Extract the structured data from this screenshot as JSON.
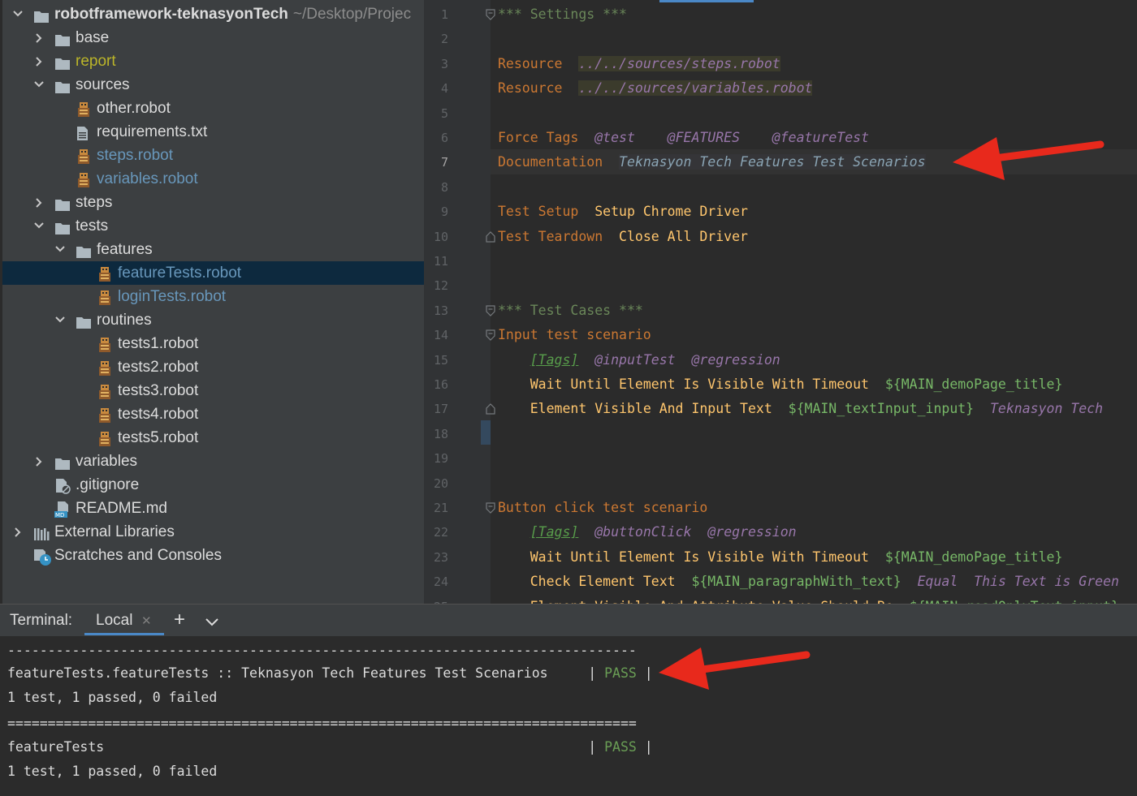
{
  "project_tree": [
    {
      "label": "robotframework-teknasyonTech",
      "extra": "~/Desktop/Projec",
      "type": "folder",
      "state": "open",
      "bold": true
    },
    {
      "label": "base",
      "type": "folder",
      "state": "closed"
    },
    {
      "label": "report",
      "type": "folder",
      "state": "closed",
      "color": "#bbb529"
    },
    {
      "label": "sources",
      "type": "folder",
      "state": "open"
    },
    {
      "label": "other.robot",
      "type": "robot"
    },
    {
      "label": "requirements.txt",
      "type": "text"
    },
    {
      "label": "steps.robot",
      "type": "robot",
      "color": "#6897bb"
    },
    {
      "label": "variables.robot",
      "type": "robot",
      "color": "#6897bb"
    },
    {
      "label": "steps",
      "type": "folder",
      "state": "closed"
    },
    {
      "label": "tests",
      "type": "folder",
      "state": "open"
    },
    {
      "label": "features",
      "type": "folder",
      "state": "open"
    },
    {
      "label": "featureTests.robot",
      "type": "robot",
      "color": "#6897bb",
      "selected": true
    },
    {
      "label": "loginTests.robot",
      "type": "robot",
      "color": "#6897bb"
    },
    {
      "label": "routines",
      "type": "folder",
      "state": "open"
    },
    {
      "label": "tests1.robot",
      "type": "robot"
    },
    {
      "label": "tests2.robot",
      "type": "robot"
    },
    {
      "label": "tests3.robot",
      "type": "robot"
    },
    {
      "label": "tests4.robot",
      "type": "robot"
    },
    {
      "label": "tests5.robot",
      "type": "robot"
    },
    {
      "label": "variables",
      "type": "folder",
      "state": "closed"
    },
    {
      "label": ".gitignore",
      "type": "gitignore"
    },
    {
      "label": "README.md",
      "type": "md"
    },
    {
      "label": "External Libraries",
      "type": "libraries",
      "state": "closed"
    },
    {
      "label": "Scratches and Consoles",
      "type": "scratches"
    }
  ],
  "editor": {
    "current_line": 7,
    "lines": [
      {
        "n": 1,
        "fold": "start",
        "tokens": [
          {
            "t": "*** Settings ***",
            "c": "c-sect"
          }
        ]
      },
      {
        "n": 2,
        "tokens": []
      },
      {
        "n": 3,
        "tokens": [
          {
            "t": "Resource",
            "c": "c-kw"
          },
          {
            "t": "  "
          },
          {
            "t": "../../sources/steps.robot",
            "c": "c-res"
          }
        ]
      },
      {
        "n": 4,
        "tokens": [
          {
            "t": "Resource",
            "c": "c-kw"
          },
          {
            "t": "  "
          },
          {
            "t": "../../sources/variables.robot",
            "c": "c-res"
          }
        ]
      },
      {
        "n": 5,
        "tokens": []
      },
      {
        "n": 6,
        "tokens": [
          {
            "t": "Force Tags",
            "c": "c-kw"
          },
          {
            "t": "  "
          },
          {
            "t": "@test",
            "c": "c-tag"
          },
          {
            "t": "    "
          },
          {
            "t": "@FEATURES",
            "c": "c-tag"
          },
          {
            "t": "    "
          },
          {
            "t": "@featureTest",
            "c": "c-tag"
          }
        ]
      },
      {
        "n": 7,
        "tokens": [
          {
            "t": "Documentation",
            "c": "c-kw"
          },
          {
            "t": "  "
          },
          {
            "t": "Teknasyon Tech Features Test Scenarios",
            "c": "c-doc"
          }
        ]
      },
      {
        "n": 8,
        "tokens": []
      },
      {
        "n": 9,
        "tokens": [
          {
            "t": "Test Setup",
            "c": "c-kw"
          },
          {
            "t": "  "
          },
          {
            "t": "Setup Chrome Driver",
            "c": "c-call"
          }
        ]
      },
      {
        "n": 10,
        "fold": "end",
        "tokens": [
          {
            "t": "Test Teardown",
            "c": "c-kw"
          },
          {
            "t": "  "
          },
          {
            "t": "Close All Driver",
            "c": "c-call"
          }
        ]
      },
      {
        "n": 11,
        "tokens": []
      },
      {
        "n": 12,
        "tokens": []
      },
      {
        "n": 13,
        "fold": "start",
        "tokens": [
          {
            "t": "*** Test Cases ***",
            "c": "c-sect"
          }
        ]
      },
      {
        "n": 14,
        "fold": "start",
        "tokens": [
          {
            "t": "Input test scenario",
            "c": "c-tc"
          }
        ]
      },
      {
        "n": 15,
        "tokens": [
          {
            "t": "    "
          },
          {
            "t": "[Tags]",
            "c": "c-tagkw"
          },
          {
            "t": "  "
          },
          {
            "t": "@inputTest",
            "c": "c-tag"
          },
          {
            "t": "  "
          },
          {
            "t": "@regression",
            "c": "c-tag"
          }
        ]
      },
      {
        "n": 16,
        "tokens": [
          {
            "t": "    "
          },
          {
            "t": "Wait Until Element Is Visible With Timeout",
            "c": "c-call"
          },
          {
            "t": "  "
          },
          {
            "t": "${MAIN_demoPage_title}",
            "c": "c-var"
          }
        ]
      },
      {
        "n": 17,
        "fold": "end",
        "tokens": [
          {
            "t": "    "
          },
          {
            "t": "Element Visible And Input Text",
            "c": "c-call"
          },
          {
            "t": "  "
          },
          {
            "t": "${MAIN_textInput_input}",
            "c": "c-var"
          },
          {
            "t": "  "
          },
          {
            "t": "Teknasyon Tech",
            "c": "c-str"
          }
        ]
      },
      {
        "n": 18,
        "tokens": []
      },
      {
        "n": 19,
        "tokens": []
      },
      {
        "n": 20,
        "tokens": []
      },
      {
        "n": 21,
        "fold": "start",
        "tokens": [
          {
            "t": "Button click test scenario",
            "c": "c-tc"
          }
        ]
      },
      {
        "n": 22,
        "tokens": [
          {
            "t": "    "
          },
          {
            "t": "[Tags]",
            "c": "c-tagkw"
          },
          {
            "t": "  "
          },
          {
            "t": "@buttonClick",
            "c": "c-tag"
          },
          {
            "t": "  "
          },
          {
            "t": "@regression",
            "c": "c-tag"
          }
        ]
      },
      {
        "n": 23,
        "tokens": [
          {
            "t": "    "
          },
          {
            "t": "Wait Until Element Is Visible With Timeout",
            "c": "c-call"
          },
          {
            "t": "  "
          },
          {
            "t": "${MAIN_demoPage_title}",
            "c": "c-var"
          }
        ]
      },
      {
        "n": 24,
        "tokens": [
          {
            "t": "    "
          },
          {
            "t": "Check Element Text",
            "c": "c-call"
          },
          {
            "t": "  "
          },
          {
            "t": "${MAIN_paragraphWith_text}",
            "c": "c-var"
          },
          {
            "t": "  "
          },
          {
            "t": "Equal",
            "c": "c-str"
          },
          {
            "t": "  "
          },
          {
            "t": "This Text is Green",
            "c": "c-str"
          }
        ]
      },
      {
        "n": 25,
        "tokens": [
          {
            "t": "    "
          },
          {
            "t": "Element Visible And Attribute Value Should Be",
            "c": "c-call"
          },
          {
            "t": "  "
          },
          {
            "t": "${MAIN_readOnlyText_input}",
            "c": "c-var"
          }
        ]
      }
    ]
  },
  "terminal": {
    "title": "Terminal:",
    "tab_label": "Local",
    "add_label": "+",
    "separator_dash": "------------------------------------------------------------------------------",
    "separator_eq": "==============================================================================",
    "suite_line_text": "featureTests.featureTests :: Teknasyon Tech Features Test Scenarios     | ",
    "pass_label": "PASS",
    "pipe_end": " |",
    "summary_line": "1 test, 1 passed, 0 failed",
    "total_line_text": "featureTests                                                            | "
  },
  "colors": {
    "arrow": "#e8291c",
    "accent": "#4a88c7",
    "pass": "#6a9e55"
  }
}
